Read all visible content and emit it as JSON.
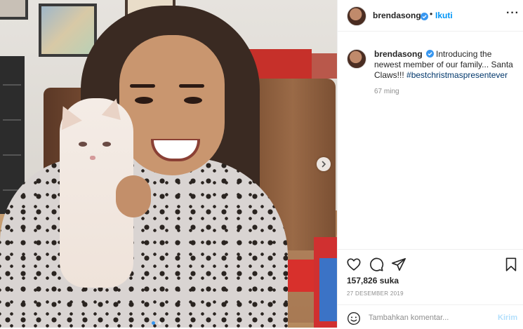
{
  "post": {
    "username": "brendasong",
    "verified": true,
    "follow_label": "Ikuti",
    "separator": "•",
    "more_icon": "more-icon"
  },
  "caption": {
    "username": "brendasong",
    "text": "Introducing the newest member of our family... Santa Claws!!! ",
    "hashtag": "#bestchristmaspresentever",
    "time_ago": "67 ming"
  },
  "engagement": {
    "likes": "157,826 suka",
    "date": "27 DESEMBER 2019"
  },
  "comment": {
    "placeholder": "Tambahkan komentar...",
    "post_label": "Kirim"
  },
  "carousel": {
    "total": 2,
    "current": 1
  },
  "colors": {
    "accent": "#0095f6",
    "hashtag": "#00376b",
    "muted": "#8e8e8e",
    "post_disabled": "#b2dffc"
  },
  "icons": [
    "heart-icon",
    "comment-icon",
    "share-icon",
    "bookmark-icon",
    "emoji-icon",
    "chevron-right-icon",
    "verified-badge-icon"
  ]
}
